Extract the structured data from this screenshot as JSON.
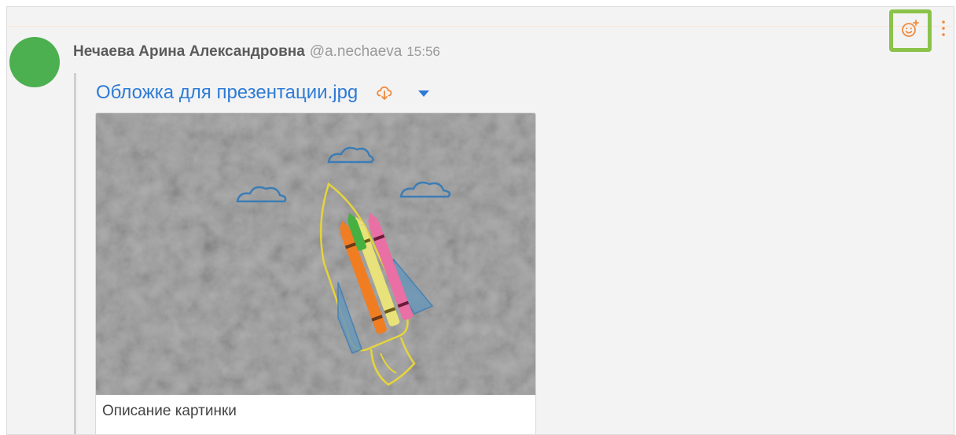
{
  "message": {
    "author_name": "Нечаева Арина Александровна",
    "username": "@a.nechaeva",
    "time": "15:56",
    "avatar_color": "#4caf50"
  },
  "attachment": {
    "file_name": "Обложка для презентации.jpg",
    "caption": "Описание картинки",
    "download_icon": "cloud-download-icon",
    "dropdown_icon": "caret-down-icon",
    "image_content": "chalk-drawn rocket with crayons on concrete"
  },
  "actions": {
    "add_reaction_icon": "add-reaction-icon",
    "more_icon": "more-vertical-icon",
    "highlight_color": "#8bc34a",
    "accent_color": "#f08a3e"
  },
  "colors": {
    "link": "#2e7bd6",
    "background": "#f3f3f3"
  }
}
